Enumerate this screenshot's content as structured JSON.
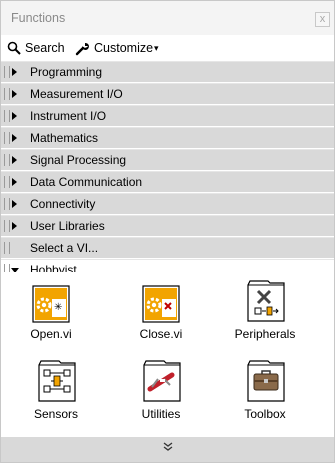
{
  "window": {
    "title": "Functions",
    "close_glyph": "x"
  },
  "toolbar": {
    "search_label": "Search",
    "customize_label": "Customize",
    "customize_arrow": "▾"
  },
  "categories": [
    {
      "label": "Programming",
      "expanded": false
    },
    {
      "label": "Measurement I/O",
      "expanded": false
    },
    {
      "label": "Instrument I/O",
      "expanded": false
    },
    {
      "label": "Mathematics",
      "expanded": false
    },
    {
      "label": "Signal Processing",
      "expanded": false
    },
    {
      "label": "Data Communication",
      "expanded": false
    },
    {
      "label": "Connectivity",
      "expanded": false
    },
    {
      "label": "User Libraries",
      "expanded": false
    },
    {
      "label": "Select a VI...",
      "expanded": null
    },
    {
      "label": "Hobbyist",
      "expanded": true
    }
  ],
  "palette": {
    "items": [
      {
        "label": "Open.vi",
        "icon": "open-vi-icon"
      },
      {
        "label": "Close.vi",
        "icon": "close-vi-icon"
      },
      {
        "label": "Peripherals",
        "icon": "peripherals-folder-icon"
      },
      {
        "label": "Sensors",
        "icon": "sensors-folder-icon"
      },
      {
        "label": "Utilities",
        "icon": "utilities-folder-icon"
      },
      {
        "label": "Toolbox",
        "icon": "toolbox-folder-icon"
      }
    ]
  },
  "footer": {
    "expand_glyph": "⌄⌄"
  },
  "colors": {
    "category_bg": "#d9d9d9",
    "vi_orange": "#f2a400"
  }
}
